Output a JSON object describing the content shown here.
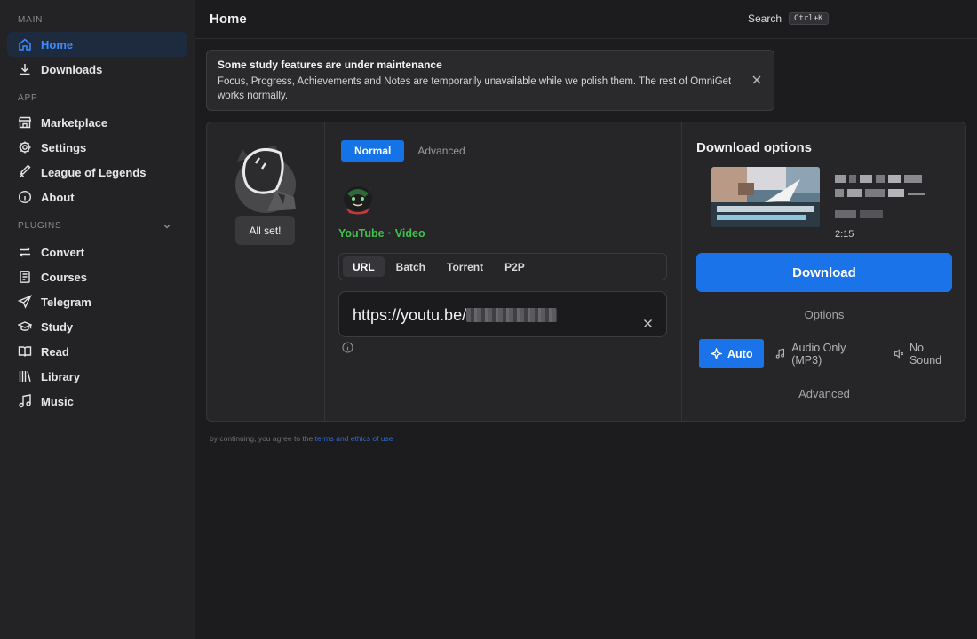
{
  "sidebar": {
    "sections": {
      "main": "MAIN",
      "app": "APP",
      "plugins": "PLUGINS"
    },
    "main_items": [
      {
        "label": "Home",
        "icon": "home-icon",
        "active": true
      },
      {
        "label": "Downloads",
        "icon": "download-icon"
      }
    ],
    "app_items": [
      {
        "label": "Marketplace",
        "icon": "store-icon"
      },
      {
        "label": "Settings",
        "icon": "gear-icon"
      },
      {
        "label": "League of Legends",
        "icon": "sword-icon"
      },
      {
        "label": "About",
        "icon": "info-icon"
      }
    ],
    "plugin_items": [
      {
        "label": "Convert",
        "icon": "arrows-icon"
      },
      {
        "label": "Courses",
        "icon": "document-icon"
      },
      {
        "label": "Telegram",
        "icon": "send-icon"
      },
      {
        "label": "Study",
        "icon": "graduation-cap-icon"
      },
      {
        "label": "Read",
        "icon": "book-icon"
      },
      {
        "label": "Library",
        "icon": "library-icon"
      },
      {
        "label": "Music",
        "icon": "music-note-icon"
      }
    ]
  },
  "header": {
    "title": "Home",
    "search_label": "Search",
    "search_shortcut": "Ctrl+K"
  },
  "banner": {
    "title": "Some study features are under maintenance",
    "text": "Focus, Progress, Achievements and Notes are temporarily unavailable while we polish them. The rest of OmniGet works normally."
  },
  "status": {
    "label": "All set!"
  },
  "mode_tabs": [
    "Normal",
    "Advanced"
  ],
  "source": {
    "platform": "YouTube",
    "separator": "·",
    "kind": "Video"
  },
  "input_tabs": [
    "URL",
    "Batch",
    "Torrent",
    "P2P"
  ],
  "url_input": {
    "value": "https://youtu.be/"
  },
  "download": {
    "title": "Download options",
    "duration": "2:15",
    "button_label": "Download",
    "options_label": "Options",
    "formats": [
      {
        "label": "Auto",
        "icon": "sparkle-icon",
        "active": true
      },
      {
        "label": "Audio Only (MP3)",
        "icon": "music-note-icon"
      },
      {
        "label": "No Sound",
        "icon": "mute-icon"
      }
    ],
    "advanced_label": "Advanced"
  },
  "footer": {
    "prefix": "by continuing, you agree to the ",
    "link": "terms and ethics of use"
  },
  "colors": {
    "accent": "#1a73e8",
    "active_nav": "#3d8bff",
    "source_green": "#3ec44a"
  }
}
